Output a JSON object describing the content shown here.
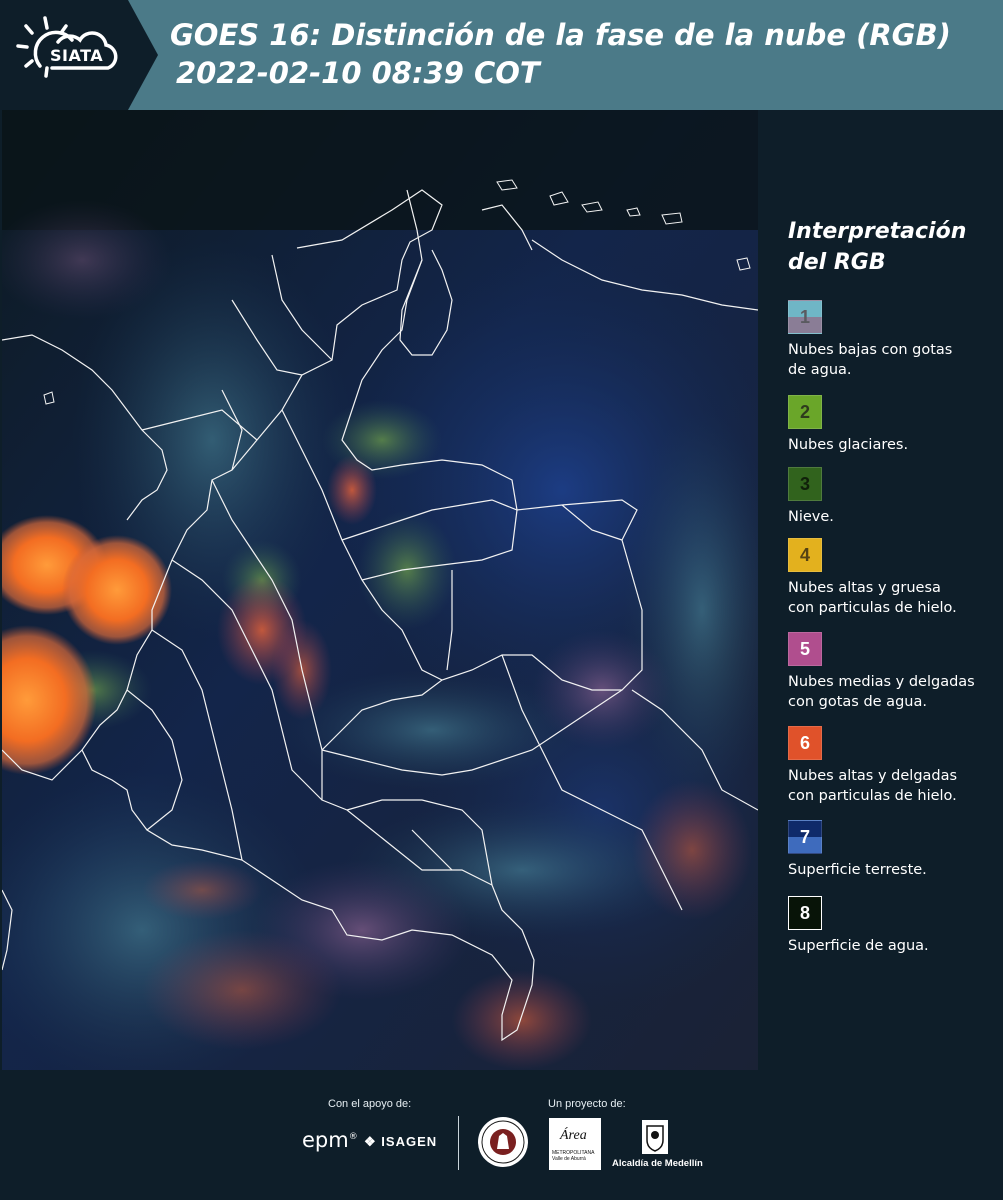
{
  "header": {
    "logo_text": "SIATA",
    "title_line1": "GOES 16: Distinción de la fase de la nube (RGB)",
    "title_line2": "2022-02-10 08:39 COT",
    "bg_color": "#4b7a88"
  },
  "map": {
    "description_icon": "satellite-rgb-image"
  },
  "legend": {
    "title_line1": "Interpretación",
    "title_line2": "del RGB",
    "items": [
      {
        "number": "1",
        "label_line1": "Nubes bajas con gotas",
        "label_line2": "de agua.",
        "color_top": "#6fb6c6",
        "color_bottom": "#8a7d96",
        "num_color": "#5a5a60"
      },
      {
        "number": "2",
        "label_line1": "Nubes glaciares.",
        "label_line2": "",
        "color_top": "#6aa629",
        "color_bottom": "#6aa629",
        "num_color": "#2e3b1d"
      },
      {
        "number": "3",
        "label_line1": "Nieve.",
        "label_line2": "",
        "color_top": "#31631d",
        "color_bottom": "#31631d",
        "num_color": "#10200a"
      },
      {
        "number": "4",
        "label_line1": "Nubes altas y gruesa",
        "label_line2": "con particulas de hielo.",
        "color_top": "#e3b11e",
        "color_bottom": "#e3b11e",
        "num_color": "#544214"
      },
      {
        "number": "5",
        "label_line1": "Nubes medias y delgadas",
        "label_line2": "con gotas de agua.",
        "color_top": "#b04e8e",
        "color_bottom": "#b04e8e",
        "num_color": "#ffffff"
      },
      {
        "number": "6",
        "label_line1": "Nubes altas y delgadas",
        "label_line2": "con particulas de hielo.",
        "color_top": "#e0522a",
        "color_bottom": "#e0522a",
        "num_color": "#ffffff"
      },
      {
        "number": "7",
        "label_line1": "Superficie terreste.",
        "label_line2": "",
        "color_top": "#0f2a6a",
        "color_bottom": "#3e6bbd",
        "num_color": "#ffffff"
      },
      {
        "number": "8",
        "label_line1": "Superficie de agua.",
        "label_line2": "",
        "color_top": "#081408",
        "color_bottom": "#081408",
        "num_color": "#ffffff"
      }
    ]
  },
  "footer": {
    "support_label": "Con el apoyo de:",
    "project_label": "Un proyecto de:",
    "epm": "epm",
    "epm_mark": "®",
    "isagen": "ISAGEN",
    "area_word": "Área",
    "area_small_1": "METROPOLITANA",
    "area_small_2": "Valle de Aburrá",
    "alcaldia": "Alcaldía de Medellín"
  }
}
